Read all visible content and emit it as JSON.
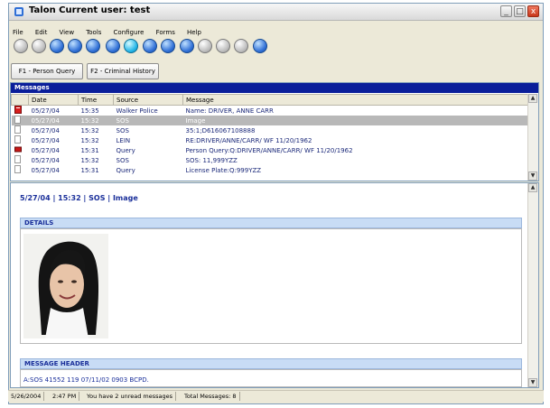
{
  "window": {
    "title": "Talon   Current user: test",
    "minimize": "_",
    "maximize": "□",
    "close": "x"
  },
  "menu": [
    "File",
    "Edit",
    "View",
    "Tools",
    "Configure",
    "Forms",
    "Help"
  ],
  "toolbar_icons": [
    "gray-circle-icon",
    "gray-circle-icon",
    "blue-circle-icon",
    "blue-circle-icon",
    "blue-circle-icon",
    "blue-circle-icon",
    "cyan-circle-icon",
    "blue-circle-icon",
    "blue-circle-icon",
    "blue-circle-icon",
    "gray-circle-icon",
    "gray-circle-icon",
    "gray-circle-icon",
    "blue-circle-icon"
  ],
  "function_buttons": [
    "F1 - Person Query",
    "F2 - Criminal History"
  ],
  "messages": {
    "header": "Messages",
    "columns": [
      "",
      "Date",
      "Time",
      "Source",
      "Message"
    ],
    "rows": [
      {
        "icon": "new",
        "date": "05/27/04",
        "time": "15:35",
        "source": "Walker Police",
        "message": "Name: DRIVER, ANNE CARR"
      },
      {
        "icon": "read",
        "date": "05/27/04",
        "time": "15:32",
        "source": "SOS",
        "message": "Image",
        "selected": true
      },
      {
        "icon": "read",
        "date": "05/27/04",
        "time": "15:32",
        "source": "SOS",
        "message": "35:1;D616067108888"
      },
      {
        "icon": "read",
        "date": "05/27/04",
        "time": "15:32",
        "source": "LEIN",
        "message": "RE:DRIVER/ANNE/CARR/ WF 11/20/1962"
      },
      {
        "icon": "alert",
        "date": "05/27/04",
        "time": "15:31",
        "source": "Query",
        "message": "Person Query:Q:DRIVER/ANNE/CARR/ WF 11/20/1962"
      },
      {
        "icon": "read",
        "date": "05/27/04",
        "time": "15:32",
        "source": "SOS",
        "message": "SOS: 11,999YZZ"
      },
      {
        "icon": "read",
        "date": "05/27/04",
        "time": "15:31",
        "source": "Query",
        "message": "License Plate:Q:999YZZ"
      }
    ]
  },
  "detail": {
    "breadcrumb": "5/27/04 | 15:32 | SOS | Image",
    "details_title": "DETAILS",
    "message_header_title": "MESSAGE HEADER",
    "message_header_text": "A:SOS 41552 119 07/11/02 0903 BCPD."
  },
  "status": {
    "date": "5/26/2004",
    "time": "2:47 PM",
    "unread": "You have 2 unread messages",
    "total": "Total Messages: 8"
  }
}
